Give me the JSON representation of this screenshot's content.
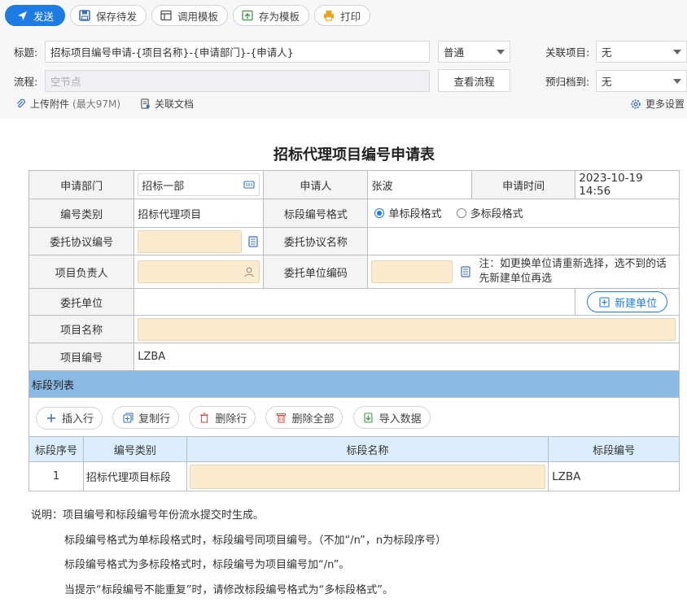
{
  "toolbar": {
    "send": "发送",
    "save_draft": "保存待发",
    "load_template": "调用模板",
    "save_template": "存为模板",
    "print": "打印"
  },
  "header": {
    "title_label": "标题:",
    "title_value": "招标项目编号申请-{项目名称}-{申请部门}-{申请人}",
    "priority": "普通",
    "related_label": "关联项目:",
    "related_value": "无",
    "flow_label": "流程:",
    "flow_placeholder": "空节点",
    "view_flow": "查看流程",
    "archive_label": "预归档到:",
    "archive_value": "无",
    "upload": "上传附件",
    "upload_limit": "(最大97M)",
    "related_doc": "关联文档",
    "more_settings": "更多设置"
  },
  "form": {
    "title": "招标代理项目编号申请表",
    "dept_label": "申请部门",
    "dept_value": "招标一部",
    "applicant_label": "申请人",
    "applicant_value": "张波",
    "time_label": "申请时间",
    "time_value": "2023-10-19 14:56",
    "type_label": "编号类别",
    "type_value": "招标代理项目",
    "segfmt_label": "标段编号格式",
    "segfmt_single": "单标段格式",
    "segfmt_multi": "多标段格式",
    "agreement_no_label": "委托协议编号",
    "agreement_name_label": "委托协议名称",
    "manager_label": "项目负责人",
    "unit_code_label": "委托单位编码",
    "unit_note": "注：如更换单位请重新选择，选不到的话先新建单位再选",
    "unit_label": "委托单位",
    "new_unit": "新建单位",
    "project_name_label": "项目名称",
    "project_no_label": "项目编号",
    "project_no_value": "LZBA"
  },
  "segments": {
    "section_title": "标段列表",
    "actions": [
      "插入行",
      "复制行",
      "删除行",
      "删除全部",
      "导入数据"
    ],
    "columns": [
      "标段序号",
      "编号类别",
      "标段名称",
      "标段编号"
    ],
    "rows": [
      {
        "seq": "1",
        "type": "招标代理项目标段",
        "name": "",
        "code": "LZBA"
      }
    ]
  },
  "notes": {
    "lead": "说明：项目编号和标段编号年份流水提交时生成。",
    "line1": "标段编号格式为单标段格式时，标段编号同项目编号。（不加“/n”，n为标段序号）",
    "line2": "标段编号格式为多标段格式时，标段编号为项目编号加“/n”。",
    "line3": "当提示“标段编号不能重复”时，请修改标段编号格式为“多标段格式”。"
  },
  "colors": {
    "accent": "#1e7be4",
    "input_fill": "#fdebd0",
    "section": "#8cb9e3",
    "header_row": "#dceefd"
  }
}
